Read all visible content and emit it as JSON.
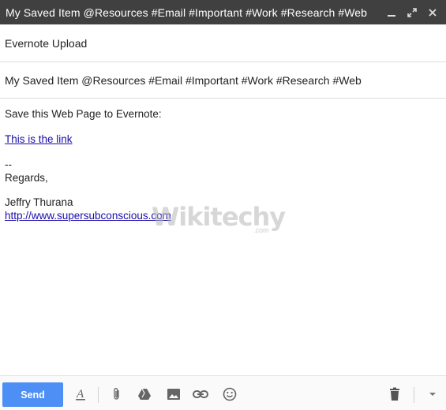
{
  "window": {
    "title": "My Saved Item @Resources #Email #Important #Work #Research #Web",
    "controls": [
      "minimize-icon",
      "expand-icon",
      "close-icon"
    ]
  },
  "compose": {
    "to": "Evernote Upload",
    "subject": "My Saved Item @Resources #Email #Important #Work #Research #Web"
  },
  "message": {
    "intro": "Save this Web Page to Evernote:",
    "link_text": "This is the link",
    "sig_dashes": "--",
    "regards": "Regards,",
    "name": "Jeffry Thurana",
    "url": "http://www.supersubconscious.com"
  },
  "watermark": {
    "brand": "Wikitechy",
    "domain": ".com"
  },
  "toolbar": {
    "send_label": "Send",
    "icons": [
      "format-text-icon",
      "attach-icon",
      "drive-icon",
      "photo-icon",
      "link-icon",
      "emoji-icon",
      "trash-icon",
      "more-options-icon"
    ]
  },
  "colors": {
    "titlebar": "#404040",
    "send_button": "#4d8ff5",
    "link": "#1a0dab"
  }
}
